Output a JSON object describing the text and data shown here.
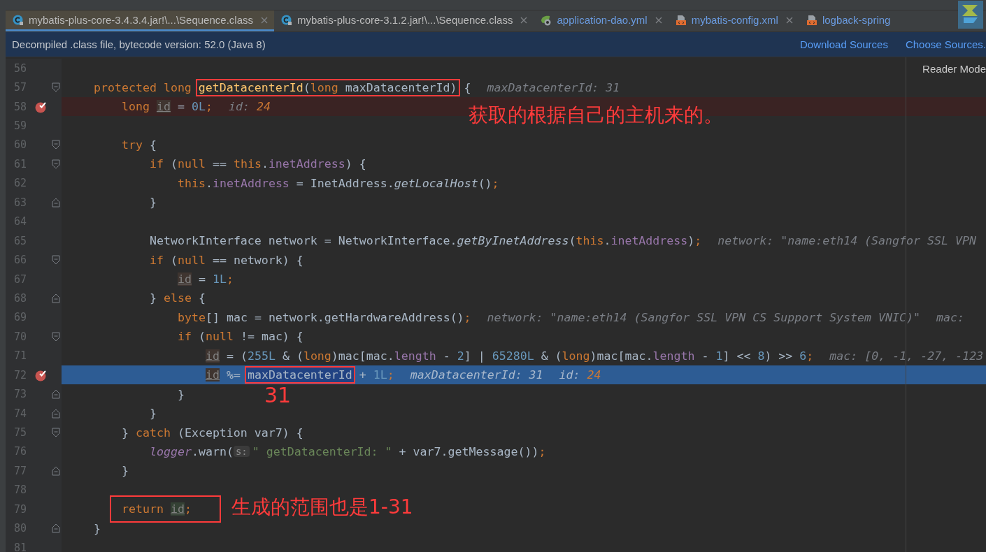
{
  "tabs": [
    {
      "label": "mybatis-plus-core-3.4.3.4.jar!\\...\\Sequence.class",
      "kind": "class",
      "selected": true,
      "closable": true,
      "modified": false
    },
    {
      "label": "mybatis-plus-core-3.1.2.jar!\\...\\Sequence.class",
      "kind": "class",
      "selected": false,
      "closable": true,
      "modified": false
    },
    {
      "label": "application-dao.yml",
      "kind": "yml",
      "selected": false,
      "closable": true,
      "modified": true
    },
    {
      "label": "mybatis-config.xml",
      "kind": "xml",
      "selected": false,
      "closable": true,
      "modified": true
    },
    {
      "label": "logback-spring",
      "kind": "xml",
      "selected": false,
      "closable": false,
      "modified": true
    }
  ],
  "info_bar": {
    "message": "Decompiled .class file, bytecode version: 52.0 (Java 8)",
    "links": [
      "Download Sources",
      "Choose Sources."
    ]
  },
  "reader_mode": "Reader Mode",
  "lines": [
    {
      "no": "56",
      "breakpoint": false,
      "current": false
    },
    {
      "no": "57",
      "kind": "fold-start",
      "breakpoint": false,
      "current": false,
      "tokens": [
        {
          "kind": "kw",
          "t": "protected long "
        },
        {
          "kind": "box",
          "parts": [
            {
              "kind": "decl",
              "t": "getDatacenterId"
            },
            {
              "kind": "pl",
              "t": "("
            },
            {
              "kind": "kw",
              "t": "long"
            },
            {
              "kind": "pl",
              "t": " maxDatacenterId)"
            }
          ]
        },
        {
          "kind": "pl",
          "t": " {"
        },
        {
          "kind": "hint",
          "t": "maxDatacenterId: 31"
        }
      ],
      "children": [
        {
          "no": "58",
          "breakpoint": true,
          "current": false,
          "tokens": [
            {
              "kind": "kw",
              "t": "long "
            },
            {
              "kind": "var",
              "t": "id"
            },
            {
              "kind": "pl",
              "t": " = "
            },
            {
              "kind": "num",
              "t": "0L"
            },
            {
              "kind": "kw",
              "t": ";"
            },
            {
              "kind": "hint",
              "t": "id:",
              "v": "24"
            }
          ]
        },
        {
          "no": "59",
          "breakpoint": false,
          "current": false
        },
        {
          "no": "60",
          "kind": "fold-start",
          "breakpoint": false,
          "current": false,
          "tokens": [
            {
              "kind": "kw",
              "t": "try"
            },
            {
              "kind": "pl",
              "t": " {"
            }
          ],
          "children": [
            {
              "no": "61",
              "kind": "fold-start",
              "breakpoint": false,
              "current": false,
              "tokens": [
                {
                  "kind": "kw",
                  "t": "if"
                },
                {
                  "kind": "pl",
                  "t": " ("
                },
                {
                  "kind": "kw",
                  "t": "null"
                },
                {
                  "kind": "pl",
                  "t": " == "
                },
                {
                  "kind": "kw",
                  "t": "this"
                },
                {
                  "kind": "pl",
                  "t": "."
                },
                {
                  "kind": "fld",
                  "t": "inetAddress"
                },
                {
                  "kind": "pl",
                  "t": ") {"
                }
              ],
              "children": [
                {
                  "no": "62",
                  "breakpoint": false,
                  "current": false,
                  "tokens": [
                    {
                      "kind": "kw",
                      "t": "this"
                    },
                    {
                      "kind": "pl",
                      "t": "."
                    },
                    {
                      "kind": "fld",
                      "t": "inetAddress"
                    },
                    {
                      "kind": "pl",
                      "t": " = InetAddress."
                    },
                    {
                      "kind": "it",
                      "t": "getLocalHost"
                    },
                    {
                      "kind": "pl",
                      "t": "()"
                    },
                    {
                      "kind": "kw",
                      "t": ";"
                    }
                  ]
                }
              ]
            },
            {
              "no": "63",
              "kind": "fold-end",
              "breakpoint": false,
              "current": false,
              "tokens": [
                {
                  "kind": "pl",
                  "t": "}"
                }
              ]
            },
            {
              "no": "64",
              "breakpoint": false,
              "current": false
            },
            {
              "no": "65",
              "breakpoint": false,
              "current": false,
              "tokens": [
                {
                  "kind": "pl",
                  "t": "NetworkInterface network = NetworkInterface."
                },
                {
                  "kind": "it",
                  "t": "getByInetAddress"
                },
                {
                  "kind": "pl",
                  "t": "("
                },
                {
                  "kind": "kw",
                  "t": "this"
                },
                {
                  "kind": "pl",
                  "t": "."
                },
                {
                  "kind": "fld",
                  "t": "inetAddress"
                },
                {
                  "kind": "pl",
                  "t": ")"
                },
                {
                  "kind": "kw",
                  "t": ";"
                },
                {
                  "kind": "hint",
                  "t": "network: \"name:eth14 (Sangfor SSL VPN"
                }
              ]
            },
            {
              "no": "66",
              "kind": "fold-start",
              "breakpoint": false,
              "current": false,
              "tokens": [
                {
                  "kind": "kw",
                  "t": "if"
                },
                {
                  "kind": "pl",
                  "t": " ("
                },
                {
                  "kind": "kw",
                  "t": "null"
                },
                {
                  "kind": "pl",
                  "t": " == network) {"
                }
              ],
              "children": [
                {
                  "no": "67",
                  "breakpoint": false,
                  "current": false,
                  "tokens": [
                    {
                      "kind": "var",
                      "t": "id"
                    },
                    {
                      "kind": "pl",
                      "t": " = "
                    },
                    {
                      "kind": "num",
                      "t": "1L"
                    },
                    {
                      "kind": "kw",
                      "t": ";"
                    }
                  ]
                }
              ]
            },
            {
              "no": "68",
              "kind": "fold-end",
              "breakpoint": false,
              "current": false,
              "tokens": [
                {
                  "kind": "pl",
                  "t": "} "
                },
                {
                  "kind": "kw",
                  "t": "else"
                },
                {
                  "kind": "pl",
                  "t": " {"
                }
              ],
              "children": [
                {
                  "no": "69",
                  "breakpoint": false,
                  "current": false,
                  "tokens": [
                    {
                      "kind": "kw",
                      "t": "byte"
                    },
                    {
                      "kind": "pl",
                      "t": "[] mac = network.getHardwareAddress()"
                    },
                    {
                      "kind": "kw",
                      "t": ";"
                    },
                    {
                      "kind": "hint",
                      "t": "network: \"name:eth14 (Sangfor SSL VPN CS Support System VNIC)\""
                    },
                    {
                      "kind": "hint",
                      "t": "mac:"
                    }
                  ]
                },
                {
                  "no": "70",
                  "kind": "fold-start",
                  "breakpoint": false,
                  "current": false,
                  "tokens": [
                    {
                      "kind": "kw",
                      "t": "if"
                    },
                    {
                      "kind": "pl",
                      "t": " ("
                    },
                    {
                      "kind": "kw",
                      "t": "null"
                    },
                    {
                      "kind": "pl",
                      "t": " != mac) {"
                    }
                  ],
                  "children": [
                    {
                      "no": "71",
                      "breakpoint": false,
                      "current": false,
                      "tokens": [
                        {
                          "kind": "var",
                          "t": "id"
                        },
                        {
                          "kind": "pl",
                          "t": " = ("
                        },
                        {
                          "kind": "num",
                          "t": "255L"
                        },
                        {
                          "kind": "pl",
                          "t": " & ("
                        },
                        {
                          "kind": "kw",
                          "t": "long"
                        },
                        {
                          "kind": "pl",
                          "t": ")mac[mac."
                        },
                        {
                          "kind": "fld",
                          "t": "length"
                        },
                        {
                          "kind": "pl",
                          "t": " - "
                        },
                        {
                          "kind": "num",
                          "t": "2"
                        },
                        {
                          "kind": "pl",
                          "t": "] | "
                        },
                        {
                          "kind": "num",
                          "t": "65280L"
                        },
                        {
                          "kind": "pl",
                          "t": " & ("
                        },
                        {
                          "kind": "kw",
                          "t": "long"
                        },
                        {
                          "kind": "pl",
                          "t": ")mac[mac."
                        },
                        {
                          "kind": "fld",
                          "t": "length"
                        },
                        {
                          "kind": "pl",
                          "t": " - "
                        },
                        {
                          "kind": "num",
                          "t": "1"
                        },
                        {
                          "kind": "pl",
                          "t": "] << "
                        },
                        {
                          "kind": "num",
                          "t": "8"
                        },
                        {
                          "kind": "pl",
                          "t": ") >> "
                        },
                        {
                          "kind": "num",
                          "t": "6"
                        },
                        {
                          "kind": "kw",
                          "t": ";"
                        },
                        {
                          "kind": "hint",
                          "t": "mac: [0, -1, -27, -123"
                        }
                      ]
                    },
                    {
                      "no": "72",
                      "breakpoint": true,
                      "current": true,
                      "tokens": [
                        {
                          "kind": "var",
                          "t": "id"
                        },
                        {
                          "kind": "pl",
                          "t": " %= "
                        },
                        {
                          "kind": "box",
                          "parts": [
                            {
                              "kind": "pl",
                              "t": "maxDatacenterId"
                            }
                          ]
                        },
                        {
                          "kind": "pl",
                          "t": " + "
                        },
                        {
                          "kind": "num",
                          "t": "1L"
                        },
                        {
                          "kind": "kw",
                          "t": ";"
                        },
                        {
                          "kind": "hint",
                          "t": "maxDatacenterId: 31"
                        },
                        {
                          "kind": "hint",
                          "t": "id:",
                          "v": "24"
                        }
                      ]
                    }
                  ]
                },
                {
                  "no": "73",
                  "kind": "fold-end",
                  "breakpoint": false,
                  "current": false,
                  "tokens": [
                    {
                      "kind": "pl",
                      "t": "}"
                    }
                  ]
                }
              ]
            },
            {
              "no": "74",
              "kind": "fold-end",
              "breakpoint": false,
              "current": false,
              "tokens": [
                {
                  "kind": "pl",
                  "t": "}"
                }
              ]
            }
          ]
        },
        {
          "no": "75",
          "kind": "fold-start",
          "breakpoint": false,
          "current": false,
          "tokens": [
            {
              "kind": "pl",
              "t": "} "
            },
            {
              "kind": "kw",
              "t": "catch"
            },
            {
              "kind": "pl",
              "t": " (Exception var7) {"
            }
          ],
          "children": [
            {
              "no": "76",
              "breakpoint": false,
              "current": false,
              "tokens": [
                {
                  "kind": "itf",
                  "t": "logger"
                },
                {
                  "kind": "pl",
                  "t": ".warn("
                },
                {
                  "kind": "inlay",
                  "t": "s:"
                },
                {
                  "kind": "str",
                  "t": "\" getDatacenterId: \""
                },
                {
                  "kind": "pl",
                  "t": " + var7.getMessage())"
                },
                {
                  "kind": "kw",
                  "t": ";"
                }
              ]
            }
          ]
        },
        {
          "no": "77",
          "kind": "fold-end",
          "breakpoint": false,
          "current": false,
          "tokens": [
            {
              "kind": "pl",
              "t": "}"
            }
          ]
        },
        {
          "no": "78",
          "breakpoint": false,
          "current": false
        },
        {
          "no": "79",
          "breakpoint": false,
          "current": false,
          "tokens": [
            {
              "kind": "frame",
              "parts": [
                {
                  "kind": "kw",
                  "t": "return "
                },
                {
                  "kind": "var2",
                  "t": "id"
                },
                {
                  "kind": "kw",
                  "t": ";"
                }
              ]
            }
          ]
        }
      ]
    },
    {
      "no": "80",
      "kind": "fold-end",
      "breakpoint": false,
      "current": false,
      "tokens": [
        {
          "kind": "pl",
          "t": "}"
        }
      ]
    },
    {
      "no": "81",
      "breakpoint": false,
      "current": false
    }
  ],
  "annotations": [
    "获取的根据自己的主机来的。",
    "31",
    "生成的范围也是1-31"
  ]
}
